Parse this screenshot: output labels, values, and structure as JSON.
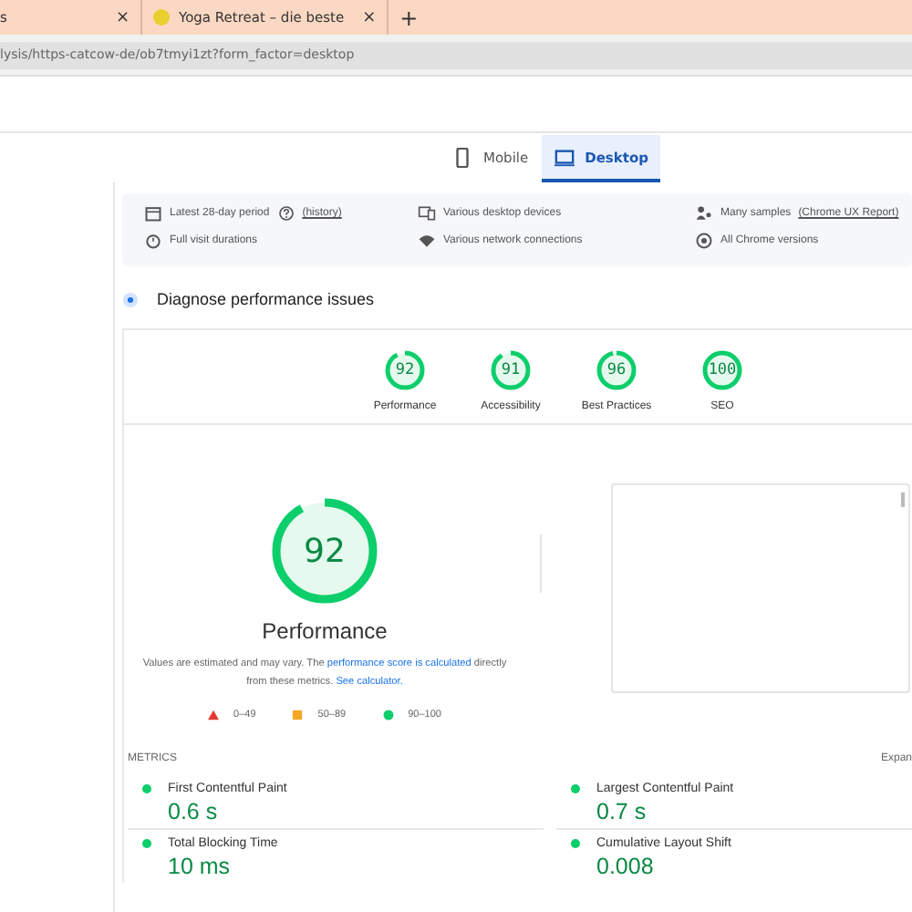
{
  "browser": {
    "tabs": [
      {
        "title": "s",
        "close": "×"
      },
      {
        "title": "Yoga Retreat – die beste",
        "close": "×"
      }
    ],
    "new_tab": "+",
    "url": "lysis/https-catcow-de/ob7tmyi1zt?form_factor=desktop"
  },
  "device_tabs": [
    {
      "label": "Mobile",
      "selected": false,
      "kind": "phone"
    },
    {
      "label": "Desktop",
      "selected": true,
      "kind": "laptop"
    }
  ],
  "field_info": [
    [
      {
        "kind": "calendar",
        "text": "Latest 28-day period",
        "help": true,
        "link": "(history)"
      },
      {
        "kind": "timer",
        "text": "Full visit durations"
      }
    ],
    [
      {
        "kind": "devices",
        "text": "Various desktop devices"
      },
      {
        "kind": "wifi",
        "text": "Various network connections"
      }
    ],
    [
      {
        "kind": "people",
        "text": "Many samples",
        "link": "(Chrome UX Report)"
      },
      {
        "kind": "globe",
        "text": "All Chrome versions"
      }
    ]
  ],
  "diagnose": {
    "title": "Diagnose performance issues"
  },
  "categories": [
    {
      "score": "92",
      "level": 0.92,
      "label": "Performance"
    },
    {
      "score": "91",
      "level": 0.91,
      "label": "Accessibility"
    },
    {
      "score": "96",
      "level": 0.96,
      "label": "Best Practices"
    },
    {
      "score": "100",
      "level": 1,
      "label": "SEO"
    }
  ],
  "main_gauge": {
    "score": "92",
    "level": 0.92,
    "label": "Performance"
  },
  "note": {
    "text": "Values are estimated and may vary. The ",
    "link1": "performance score is calculated",
    "mid": " directly from these metrics. ",
    "link2": "See calculator."
  },
  "legend": [
    {
      "kind": "triangle",
      "color": "#e53935",
      "range": "0–49"
    },
    {
      "kind": "square",
      "color": "#f4a724",
      "range": "50–89"
    },
    {
      "kind": "circle",
      "color": "#0cce6b",
      "range": "90–100"
    }
  ],
  "metrics": {
    "title": "METRICS",
    "expand": "Expan",
    "items": [
      {
        "label": "First Contentful Paint",
        "value": "0.6 s",
        "color": "#0cce6b"
      },
      {
        "label": "Largest Contentful Paint",
        "value": "0.7 s",
        "color": "#0cce6b"
      },
      {
        "label": "Total Blocking Time",
        "value": "10 ms",
        "color": "#0cce6b"
      },
      {
        "label": "Cumulative Layout Shift",
        "value": "0.008",
        "color": "#0cce6b"
      }
    ]
  }
}
